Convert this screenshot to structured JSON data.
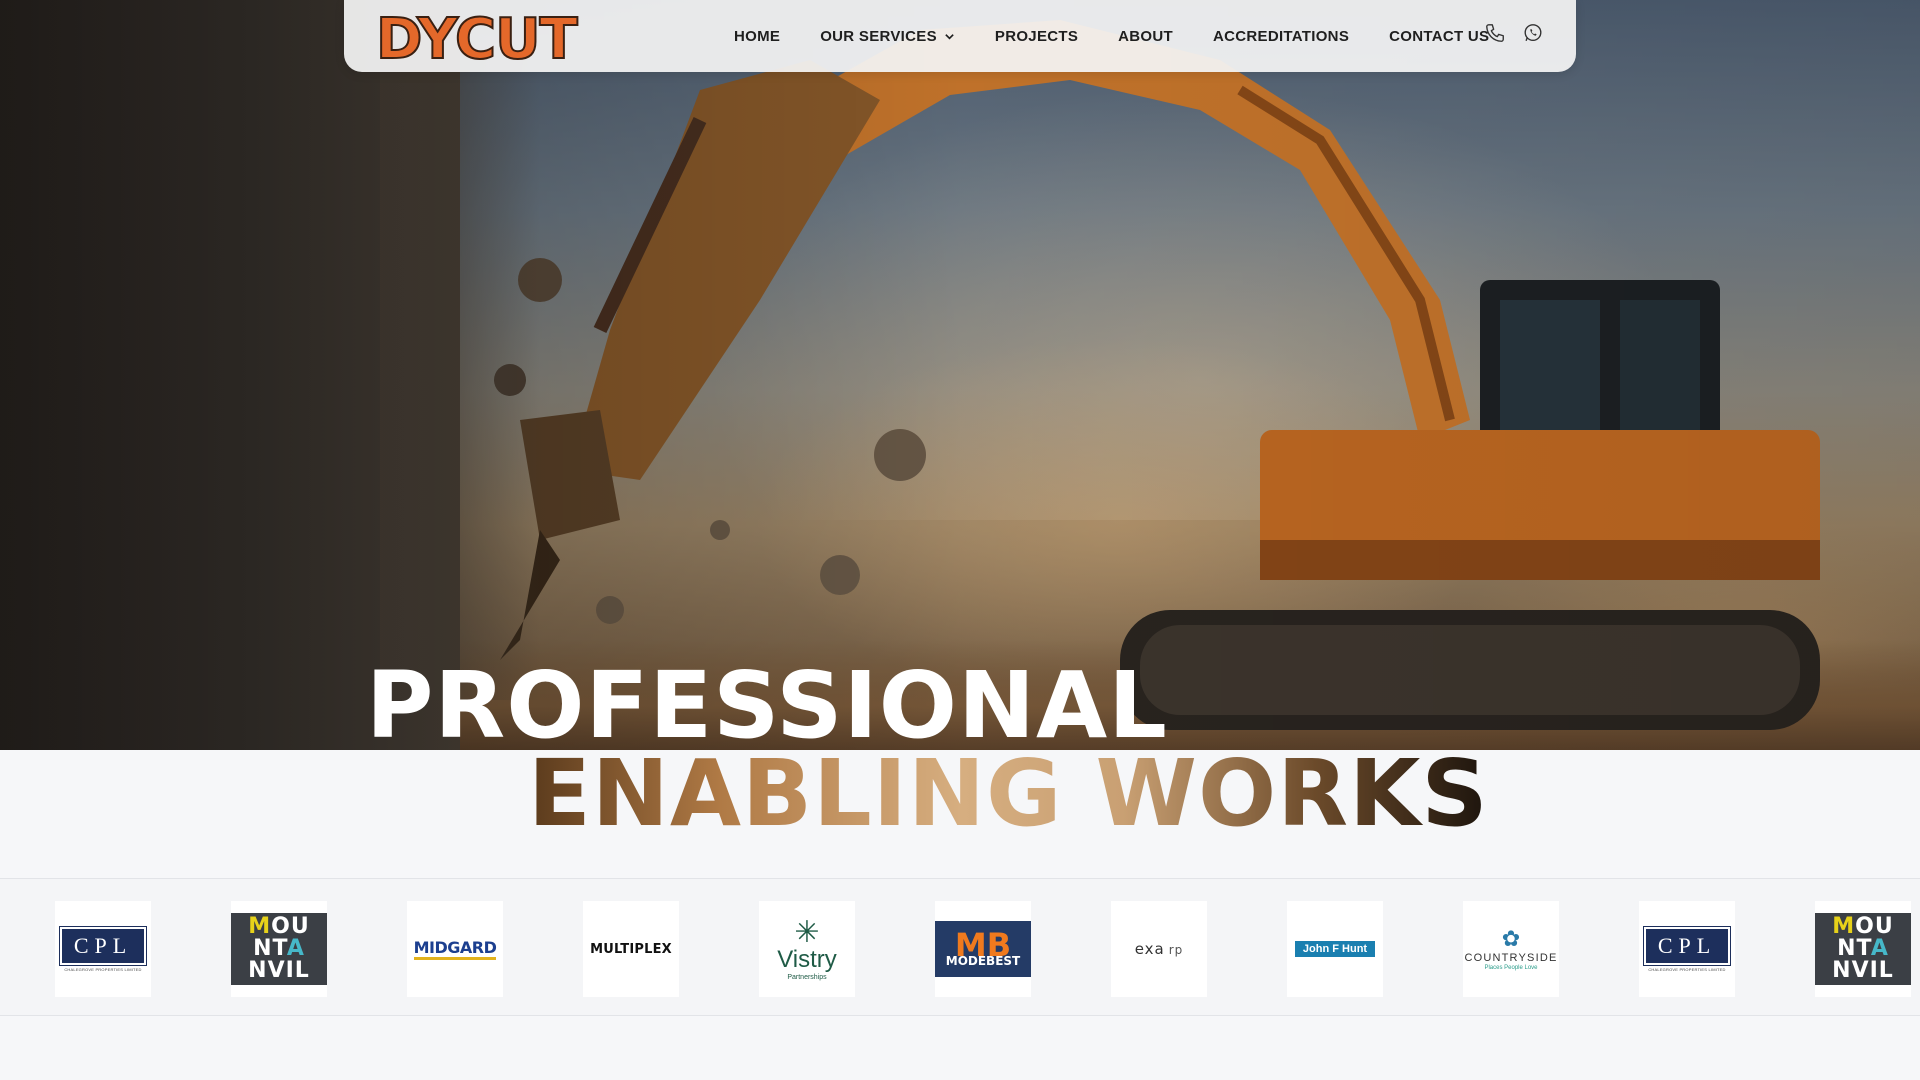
{
  "brand": {
    "logo_text": "DYCUT",
    "logo_color": "#e4682a"
  },
  "nav": {
    "items": [
      {
        "label": "HOME"
      },
      {
        "label": "OUR SERVICES",
        "has_dropdown": true
      },
      {
        "label": "PROJECTS"
      },
      {
        "label": "ABOUT"
      },
      {
        "label": "ACCREDITATIONS"
      },
      {
        "label": "CONTACT US"
      }
    ],
    "icons": [
      "phone-icon",
      "whatsapp-icon"
    ]
  },
  "hero": {
    "headline_line1": "PROFESSIONAL",
    "headline_line2": "ENABLING WORKS"
  },
  "clients": {
    "logos": [
      {
        "name": "cpl",
        "text": "CPL",
        "subtext": "CHALEGROVE PROPERTIES LIMITED"
      },
      {
        "name": "mountanvil",
        "lines": [
          "MOU",
          "NTA",
          "NVIL"
        ]
      },
      {
        "name": "midgard",
        "text": "MIDGARD"
      },
      {
        "name": "multiplex",
        "text": "MULTIPLEX"
      },
      {
        "name": "vistry",
        "text": "Vistry",
        "subtext": "Partnerships"
      },
      {
        "name": "modebest",
        "text": "MB",
        "subtext": "MODEBEST"
      },
      {
        "name": "exa",
        "text": "exa",
        "subtext": "rp"
      },
      {
        "name": "john-f-hunt",
        "text": "John F Hunt"
      },
      {
        "name": "countryside",
        "text": "COUNTRYSIDE",
        "subtext": "Places People Love"
      },
      {
        "name": "cpl-repeat",
        "text": "CPL",
        "subtext": "CHALEGROVE PROPERTIES LIMITED"
      },
      {
        "name": "mountanvil-repeat",
        "lines": [
          "MOU",
          "NTA",
          "NVIL"
        ]
      }
    ]
  }
}
